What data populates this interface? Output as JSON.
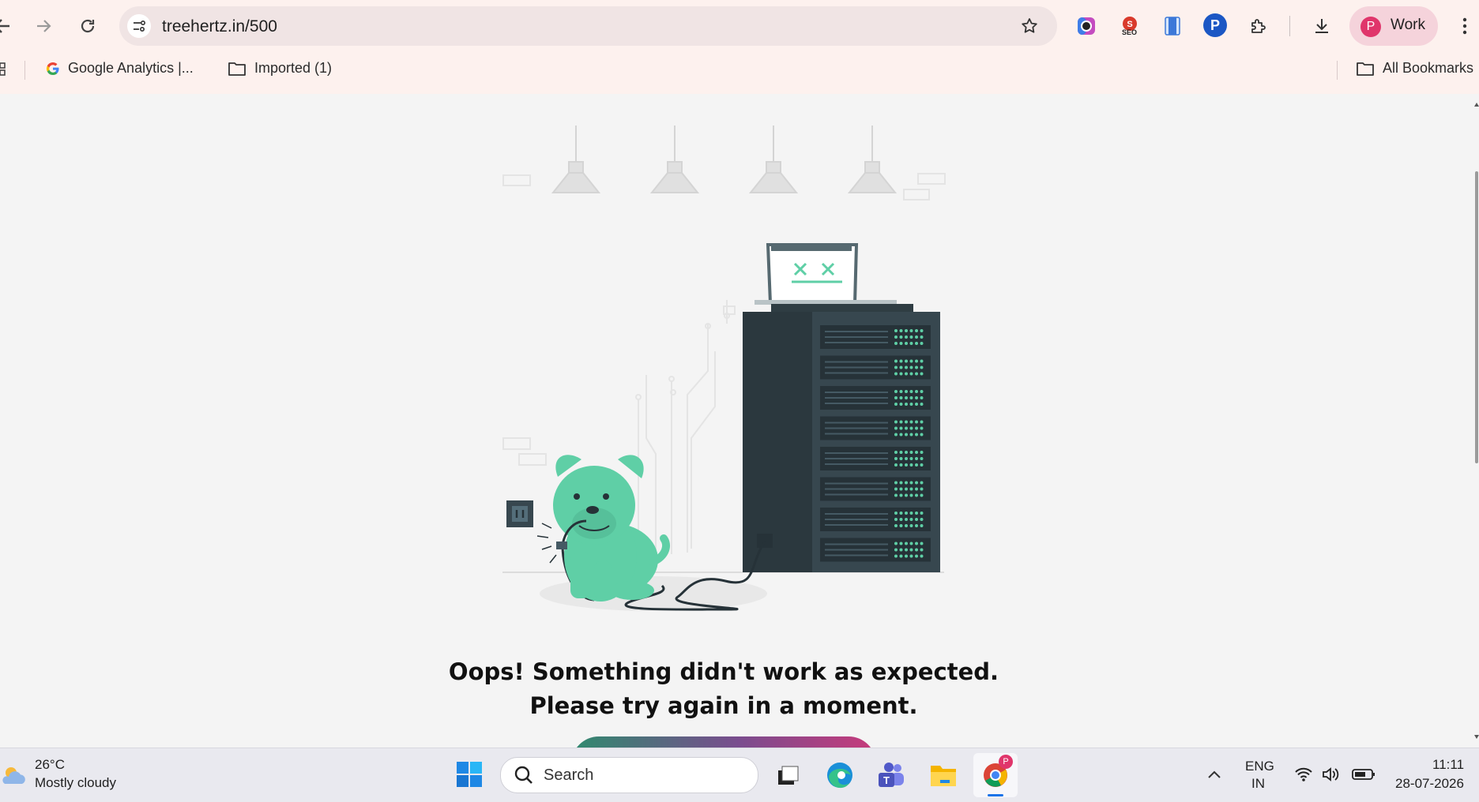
{
  "browser": {
    "url": "treehertz.in/500",
    "profile_initial": "P",
    "profile_label": "Work",
    "bookmarks": [
      {
        "label": "Google Analytics  |..."
      },
      {
        "label": "Imported (1)"
      }
    ],
    "all_bookmarks_label": "All Bookmarks",
    "extension_seo_text": "SEO",
    "extension_p_text": "P"
  },
  "page": {
    "message_line1": "Oops! Something didn't work as expected.",
    "message_line2": "Please try again in a moment."
  },
  "taskbar": {
    "weather_temp": "26°C",
    "weather_desc": "Mostly cloudy",
    "search_label": "Search",
    "lang_top": "ENG",
    "lang_bottom": "IN",
    "time": "11:11",
    "date": "28-07-2026",
    "chrome_badge": "P"
  },
  "colors": {
    "accent": "#5fcfa6",
    "server": "#37474f",
    "profile_avatar": "#e0356b"
  }
}
